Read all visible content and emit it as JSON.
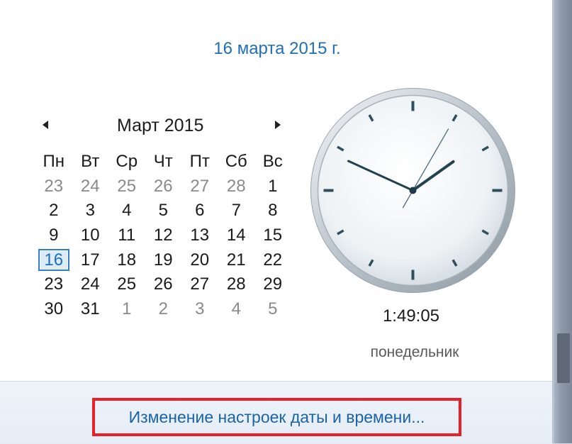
{
  "header": {
    "date_long": "16 марта 2015 г."
  },
  "calendar": {
    "month_title": "Март 2015",
    "prev_icon": "triangle-left-icon",
    "next_icon": "triangle-right-icon",
    "weekdays": [
      "Пн",
      "Вт",
      "Ср",
      "Чт",
      "Пт",
      "Сб",
      "Вс"
    ],
    "weeks": [
      [
        {
          "d": "23",
          "o": true
        },
        {
          "d": "24",
          "o": true
        },
        {
          "d": "25",
          "o": true
        },
        {
          "d": "26",
          "o": true
        },
        {
          "d": "27",
          "o": true
        },
        {
          "d": "28",
          "o": true
        },
        {
          "d": "1",
          "o": false
        }
      ],
      [
        {
          "d": "2",
          "o": false
        },
        {
          "d": "3",
          "o": false
        },
        {
          "d": "4",
          "o": false
        },
        {
          "d": "5",
          "o": false
        },
        {
          "d": "6",
          "o": false
        },
        {
          "d": "7",
          "o": false
        },
        {
          "d": "8",
          "o": false
        }
      ],
      [
        {
          "d": "9",
          "o": false
        },
        {
          "d": "10",
          "o": false
        },
        {
          "d": "11",
          "o": false
        },
        {
          "d": "12",
          "o": false
        },
        {
          "d": "13",
          "o": false
        },
        {
          "d": "14",
          "o": false
        },
        {
          "d": "15",
          "o": false
        }
      ],
      [
        {
          "d": "16",
          "o": false,
          "today": true
        },
        {
          "d": "17",
          "o": false
        },
        {
          "d": "18",
          "o": false
        },
        {
          "d": "19",
          "o": false
        },
        {
          "d": "20",
          "o": false
        },
        {
          "d": "21",
          "o": false
        },
        {
          "d": "22",
          "o": false
        }
      ],
      [
        {
          "d": "23",
          "o": false
        },
        {
          "d": "24",
          "o": false
        },
        {
          "d": "25",
          "o": false
        },
        {
          "d": "26",
          "o": false
        },
        {
          "d": "27",
          "o": false
        },
        {
          "d": "28",
          "o": false
        },
        {
          "d": "29",
          "o": false
        }
      ],
      [
        {
          "d": "30",
          "o": false
        },
        {
          "d": "31",
          "o": false
        },
        {
          "d": "1",
          "o": true
        },
        {
          "d": "2",
          "o": true
        },
        {
          "d": "3",
          "o": true
        },
        {
          "d": "4",
          "o": true
        },
        {
          "d": "5",
          "o": true
        }
      ]
    ]
  },
  "clock": {
    "hours": 1,
    "minutes": 49,
    "seconds": 5,
    "time_text": "1:49:05",
    "weekday_text": "понедельник",
    "hand_color": "#24414f",
    "tick_color": "#2d4f5f"
  },
  "footer": {
    "settings_link": "Изменение настроек даты и времени..."
  },
  "colors": {
    "accent_blue": "#1e6fb4",
    "link_blue": "#1a63a8",
    "highlight_red": "#e8202a",
    "today_border": "#2f7fc9"
  }
}
